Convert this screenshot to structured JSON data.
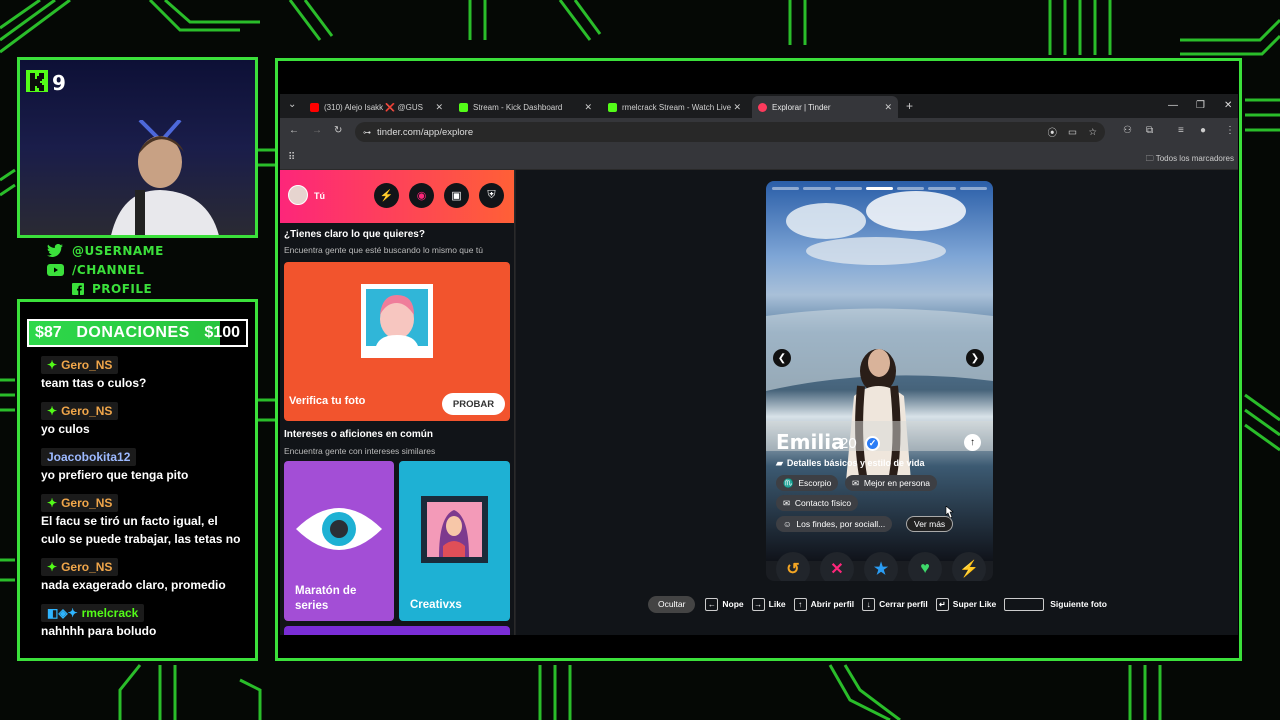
{
  "stream": {
    "viewer_count": "9",
    "socials": [
      {
        "icon": "twitter-icon",
        "label": "@USERNAME"
      },
      {
        "icon": "youtube-icon",
        "label": "/CHANNEL"
      },
      {
        "icon": "facebook-icon",
        "label": "PROFILE"
      }
    ],
    "donation": {
      "current": "$87",
      "label": "DONACIONES",
      "goal": "$100",
      "progress": 0.87
    },
    "chat": [
      {
        "user": "Gero_NS",
        "text": "team ttas o culos?"
      },
      {
        "user": "Gero_NS",
        "text": "yo culos"
      },
      {
        "user": "Joacobokita12",
        "text": "yo prefiero que tenga pito"
      },
      {
        "user": "Gero_NS",
        "text": "El facu se tiró un facto igual, el culo se puede trabajar, las tetas no"
      },
      {
        "user": "Gero_NS",
        "text": "nada exagerado claro, promedio"
      },
      {
        "user": "rmelcrack",
        "text": "nahhhh para boludo"
      }
    ]
  },
  "browser": {
    "tabs": [
      {
        "label": "(310) Alejo Isakk ❌ @GUS",
        "active": false
      },
      {
        "label": "Stream - Kick Dashboard",
        "active": false
      },
      {
        "label": "rmelcrack Stream - Watch Live",
        "active": false
      },
      {
        "label": "Explorar | Tinder",
        "active": true
      }
    ],
    "new_tab": "+",
    "url": "tinder.com/app/explore",
    "bookmarks_label": "Todos los marcadores"
  },
  "tinder": {
    "you_label": "Tú",
    "section1": {
      "title": "¿Tienes claro lo que quieres?",
      "subtitle": "Encuentra gente que esté buscando lo mismo que tú"
    },
    "verify_card": {
      "label": "Verifica tu foto",
      "button": "PROBAR"
    },
    "section2": {
      "title": "Intereses o aficiones en común",
      "subtitle": "Encuentra gente con intereses similares"
    },
    "card_eye": {
      "label": "Maratón de series"
    },
    "card_art": {
      "label": "Creativxs"
    },
    "profile": {
      "name": "Emilia",
      "age": "20",
      "details": "Detalles básicos y estilo de vida",
      "chips": [
        "Escorpio",
        "Mejor en persona",
        "Contacto físico",
        "Los findes, por sociall...",
        "Ver más"
      ],
      "photo_count": 7,
      "photo_index": 4
    },
    "shortcuts": [
      {
        "key": "",
        "label": "Ocultar"
      },
      {
        "key": "←",
        "label": "Nope"
      },
      {
        "key": "→",
        "label": "Like"
      },
      {
        "key": "↑",
        "label": "Abrir perfil"
      },
      {
        "key": "↓",
        "label": "Cerrar perfil"
      },
      {
        "key": "↵",
        "label": "Super Like"
      },
      {
        "key": "",
        "label": "Siguiente foto"
      }
    ],
    "colors": {
      "brand_start": "#fd267a",
      "brand_end": "#ff6036",
      "accent_green": "#3be03b"
    }
  }
}
